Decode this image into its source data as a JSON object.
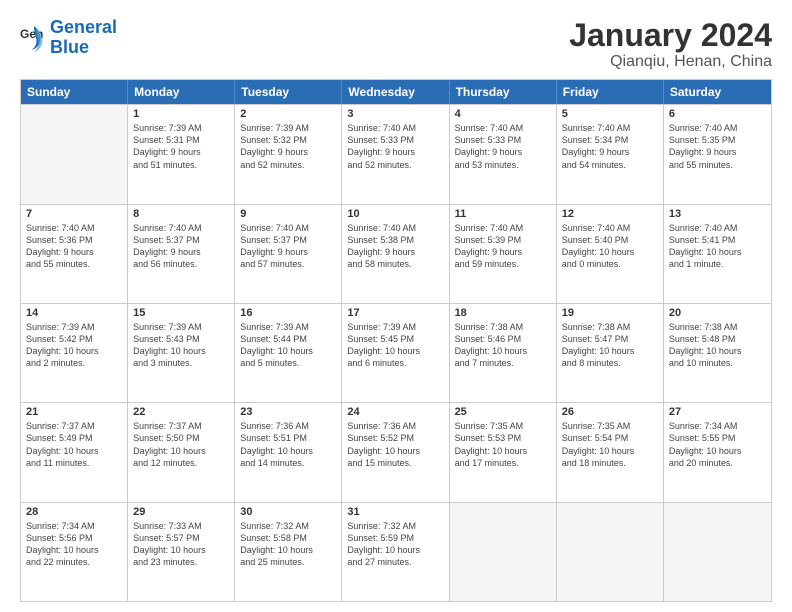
{
  "header": {
    "logo_line1": "General",
    "logo_line2": "Blue",
    "title": "January 2024",
    "subtitle": "Qianqiu, Henan, China"
  },
  "calendar": {
    "weekdays": [
      "Sunday",
      "Monday",
      "Tuesday",
      "Wednesday",
      "Thursday",
      "Friday",
      "Saturday"
    ],
    "rows": [
      [
        {
          "day": "",
          "info": "",
          "empty": true
        },
        {
          "day": "1",
          "info": "Sunrise: 7:39 AM\nSunset: 5:31 PM\nDaylight: 9 hours\nand 51 minutes.",
          "empty": false
        },
        {
          "day": "2",
          "info": "Sunrise: 7:39 AM\nSunset: 5:32 PM\nDaylight: 9 hours\nand 52 minutes.",
          "empty": false
        },
        {
          "day": "3",
          "info": "Sunrise: 7:40 AM\nSunset: 5:33 PM\nDaylight: 9 hours\nand 52 minutes.",
          "empty": false
        },
        {
          "day": "4",
          "info": "Sunrise: 7:40 AM\nSunset: 5:33 PM\nDaylight: 9 hours\nand 53 minutes.",
          "empty": false
        },
        {
          "day": "5",
          "info": "Sunrise: 7:40 AM\nSunset: 5:34 PM\nDaylight: 9 hours\nand 54 minutes.",
          "empty": false
        },
        {
          "day": "6",
          "info": "Sunrise: 7:40 AM\nSunset: 5:35 PM\nDaylight: 9 hours\nand 55 minutes.",
          "empty": false
        }
      ],
      [
        {
          "day": "7",
          "info": "Sunrise: 7:40 AM\nSunset: 5:36 PM\nDaylight: 9 hours\nand 55 minutes.",
          "empty": false
        },
        {
          "day": "8",
          "info": "Sunrise: 7:40 AM\nSunset: 5:37 PM\nDaylight: 9 hours\nand 56 minutes.",
          "empty": false
        },
        {
          "day": "9",
          "info": "Sunrise: 7:40 AM\nSunset: 5:37 PM\nDaylight: 9 hours\nand 57 minutes.",
          "empty": false
        },
        {
          "day": "10",
          "info": "Sunrise: 7:40 AM\nSunset: 5:38 PM\nDaylight: 9 hours\nand 58 minutes.",
          "empty": false
        },
        {
          "day": "11",
          "info": "Sunrise: 7:40 AM\nSunset: 5:39 PM\nDaylight: 9 hours\nand 59 minutes.",
          "empty": false
        },
        {
          "day": "12",
          "info": "Sunrise: 7:40 AM\nSunset: 5:40 PM\nDaylight: 10 hours\nand 0 minutes.",
          "empty": false
        },
        {
          "day": "13",
          "info": "Sunrise: 7:40 AM\nSunset: 5:41 PM\nDaylight: 10 hours\nand 1 minute.",
          "empty": false
        }
      ],
      [
        {
          "day": "14",
          "info": "Sunrise: 7:39 AM\nSunset: 5:42 PM\nDaylight: 10 hours\nand 2 minutes.",
          "empty": false
        },
        {
          "day": "15",
          "info": "Sunrise: 7:39 AM\nSunset: 5:43 PM\nDaylight: 10 hours\nand 3 minutes.",
          "empty": false
        },
        {
          "day": "16",
          "info": "Sunrise: 7:39 AM\nSunset: 5:44 PM\nDaylight: 10 hours\nand 5 minutes.",
          "empty": false
        },
        {
          "day": "17",
          "info": "Sunrise: 7:39 AM\nSunset: 5:45 PM\nDaylight: 10 hours\nand 6 minutes.",
          "empty": false
        },
        {
          "day": "18",
          "info": "Sunrise: 7:38 AM\nSunset: 5:46 PM\nDaylight: 10 hours\nand 7 minutes.",
          "empty": false
        },
        {
          "day": "19",
          "info": "Sunrise: 7:38 AM\nSunset: 5:47 PM\nDaylight: 10 hours\nand 8 minutes.",
          "empty": false
        },
        {
          "day": "20",
          "info": "Sunrise: 7:38 AM\nSunset: 5:48 PM\nDaylight: 10 hours\nand 10 minutes.",
          "empty": false
        }
      ],
      [
        {
          "day": "21",
          "info": "Sunrise: 7:37 AM\nSunset: 5:49 PM\nDaylight: 10 hours\nand 11 minutes.",
          "empty": false
        },
        {
          "day": "22",
          "info": "Sunrise: 7:37 AM\nSunset: 5:50 PM\nDaylight: 10 hours\nand 12 minutes.",
          "empty": false
        },
        {
          "day": "23",
          "info": "Sunrise: 7:36 AM\nSunset: 5:51 PM\nDaylight: 10 hours\nand 14 minutes.",
          "empty": false
        },
        {
          "day": "24",
          "info": "Sunrise: 7:36 AM\nSunset: 5:52 PM\nDaylight: 10 hours\nand 15 minutes.",
          "empty": false
        },
        {
          "day": "25",
          "info": "Sunrise: 7:35 AM\nSunset: 5:53 PM\nDaylight: 10 hours\nand 17 minutes.",
          "empty": false
        },
        {
          "day": "26",
          "info": "Sunrise: 7:35 AM\nSunset: 5:54 PM\nDaylight: 10 hours\nand 18 minutes.",
          "empty": false
        },
        {
          "day": "27",
          "info": "Sunrise: 7:34 AM\nSunset: 5:55 PM\nDaylight: 10 hours\nand 20 minutes.",
          "empty": false
        }
      ],
      [
        {
          "day": "28",
          "info": "Sunrise: 7:34 AM\nSunset: 5:56 PM\nDaylight: 10 hours\nand 22 minutes.",
          "empty": false
        },
        {
          "day": "29",
          "info": "Sunrise: 7:33 AM\nSunset: 5:57 PM\nDaylight: 10 hours\nand 23 minutes.",
          "empty": false
        },
        {
          "day": "30",
          "info": "Sunrise: 7:32 AM\nSunset: 5:58 PM\nDaylight: 10 hours\nand 25 minutes.",
          "empty": false
        },
        {
          "day": "31",
          "info": "Sunrise: 7:32 AM\nSunset: 5:59 PM\nDaylight: 10 hours\nand 27 minutes.",
          "empty": false
        },
        {
          "day": "",
          "info": "",
          "empty": true
        },
        {
          "day": "",
          "info": "",
          "empty": true
        },
        {
          "day": "",
          "info": "",
          "empty": true
        }
      ]
    ]
  }
}
